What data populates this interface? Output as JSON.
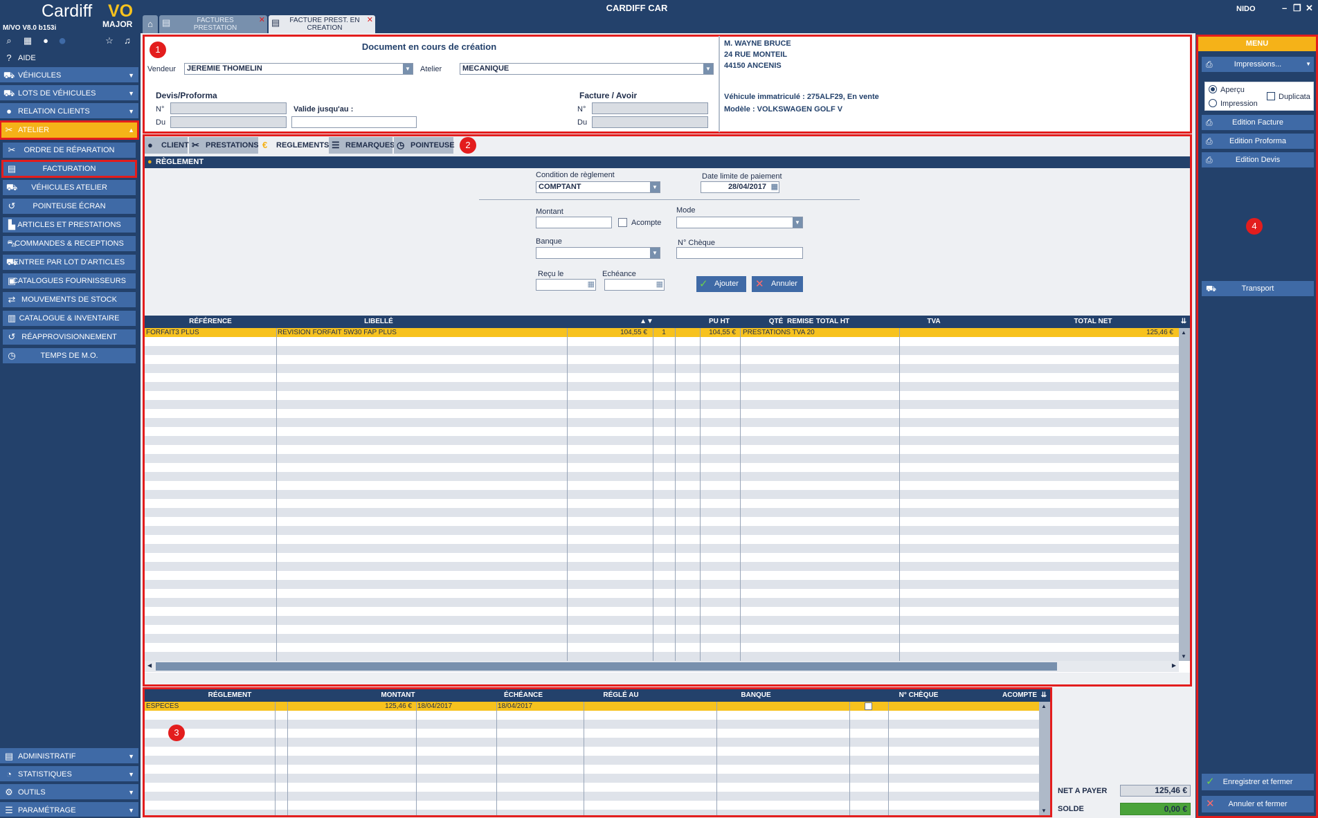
{
  "app": {
    "title": "CARDIFF CAR",
    "user": "NIDO",
    "logo_name": "Cardiff",
    "logo_vo": "VO",
    "logo_major": "MAJOR",
    "version": "M/VO V8.0 b153i"
  },
  "tabs": [
    {
      "label": "FACTURES PRESTATION"
    },
    {
      "label": "FACTURE PREST. EN CREATION"
    }
  ],
  "sidebar": {
    "aide": "AIDE",
    "vehicules": "VÉHICULES",
    "lots": "LOTS DE VÉHICULES",
    "relation": "RELATION CLIENTS",
    "atelier": "ATELIER",
    "sub": [
      "ORDRE DE RÉPARATION",
      "FACTURATION",
      "VÉHICULES ATELIER",
      "POINTEUSE ÉCRAN",
      "ARTICLES ET PRESTATIONS",
      "COMMANDES & RECEPTIONS",
      "ENTREE PAR LOT D'ARTICLES",
      "CATALOGUES FOURNISSEURS",
      "MOUVEMENTS DE STOCK",
      "CATALOGUE & INVENTAIRE",
      "RÉAPPROVISIONNEMENT",
      "TEMPS DE M.O."
    ],
    "bottom": [
      "ADMINISTRATIF",
      "STATISTIQUES",
      "OUTILS",
      "PARAMÉTRAGE"
    ]
  },
  "header": {
    "doc_title": "Document en cours de création",
    "vendeur_label": "Vendeur",
    "vendeur": "JEREMIE THOMELIN",
    "atelier_label": "Atelier",
    "atelier": "MECANIQUE",
    "devis_label": "Devis/Proforma",
    "facture_label": "Facture / Avoir",
    "no_label": "N°",
    "du_label": "Du",
    "valide_label": "Valide jusqu'au :",
    "client_name": "M. WAYNE BRUCE",
    "client_addr1": "24 RUE MONTEIL",
    "client_addr2": "44150 ANCENIS",
    "vehicle_reg": "Véhicule immatriculé : 275ALF29, En vente",
    "vehicle_model": "Modèle : VOLKSWAGEN GOLF V"
  },
  "subtabs": [
    "CLIENT",
    "PRESTATIONS",
    "REGLEMENTS",
    "REMARQUES",
    "POINTEUSE"
  ],
  "reglement_form": {
    "section": "RÈGLEMENT",
    "condition_label": "Condition de règlement",
    "condition": "COMPTANT",
    "date_limite_label": "Date limite de paiement",
    "date_limite": "28/04/2017",
    "montant_label": "Montant",
    "acompte_label": "Acompte",
    "mode_label": "Mode",
    "banque_label": "Banque",
    "cheque_label": "N° Chèque",
    "recu_label": "Reçu le",
    "echeance_label": "Echéance",
    "ajouter": "Ajouter",
    "annuler": "Annuler"
  },
  "lines_table": {
    "headers": [
      "RÉFÉRENCE",
      "LIBELLÉ",
      "PU HT",
      "QTÉ",
      "REMISE",
      "TOTAL HT",
      "TVA",
      "TOTAL NET"
    ],
    "rows": [
      [
        "FORFAIT3 PLUS",
        "REVISION FORFAIT 5W30 FAP PLUS",
        "104,55 €",
        "1",
        "",
        "104,55 €",
        "PRESTATIONS TVA 20",
        "125,46 €"
      ]
    ]
  },
  "payments_table": {
    "headers": [
      "RÉGLEMENT",
      "MONTANT",
      "ÉCHÉANCE",
      "RÉGLÉ AU",
      "BANQUE",
      "N° CHÈQUE",
      "ACOMPTE"
    ],
    "rows": [
      [
        "ESPECES",
        "125,46 €",
        "18/04/2017",
        "18/04/2017",
        "",
        "",
        ""
      ]
    ]
  },
  "totals": {
    "net_label": "NET A PAYER",
    "net": "125,46 €",
    "solde_label": "SOLDE",
    "solde": "0,00 €"
  },
  "menu": {
    "title": "MENU",
    "impressions": "Impressions...",
    "apercu": "Aperçu",
    "impression": "Impression",
    "duplicata": "Duplicata",
    "edition_facture": "Edition Facture",
    "edition_proforma": "Edition Proforma",
    "edition_devis": "Edition Devis",
    "transport": "Transport",
    "enregistrer": "Enregistrer et fermer",
    "annuler_fermer": "Annuler et fermer"
  },
  "badges": [
    "1",
    "2",
    "3",
    "4"
  ],
  "colors": {
    "navy": "#23416b",
    "accent": "#f7c21e",
    "button": "#3f6aa6",
    "highlight": "#e31d1d",
    "solde": "#4aa33a"
  }
}
